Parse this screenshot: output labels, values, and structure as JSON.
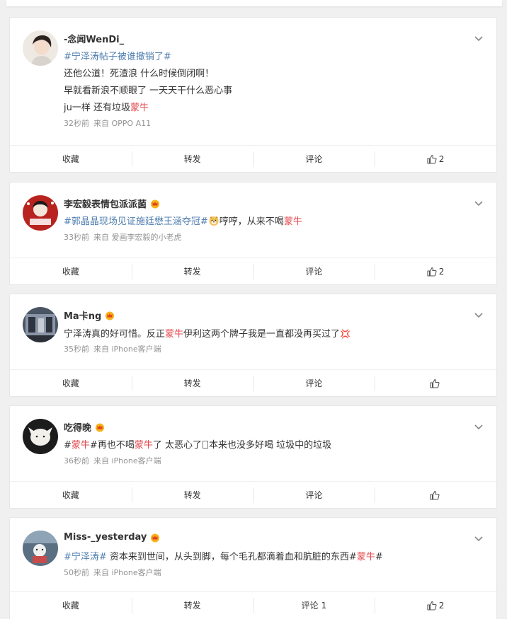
{
  "colors": {
    "topic": "#507daf",
    "highlight": "#e5484d",
    "meta": "#939393",
    "background": "#f0f0f0"
  },
  "action_labels": {
    "favorite": "收藏",
    "repost": "转发",
    "comment": "评论"
  },
  "posts": [
    {
      "username": "-念闻WenDi_",
      "has_crown": false,
      "lines": [
        [
          {
            "t": "#宁泽涛帖子被谁撤销了#",
            "s": "topic"
          }
        ],
        [
          {
            "t": "还他公道！死渣浪 什么时候倒闭啊！",
            "s": "plain"
          }
        ],
        [
          {
            "t": "早就看新浪不顺眼了 一天天干什么恶心事",
            "s": "plain"
          }
        ],
        [
          {
            "t": "ju一样 还有垃圾",
            "s": "plain"
          },
          {
            "t": "蒙牛",
            "s": "red"
          }
        ]
      ],
      "time": "32秒前",
      "source": "来自 OPPO A11",
      "comment_count": "",
      "like_count": "2"
    },
    {
      "username": "李宏毅表情包派派菌",
      "has_crown": true,
      "lines": [
        [
          {
            "t": "#郭晶晶现场见证施廷懋王涵夺冠#",
            "s": "topic"
          },
          {
            "t": "dog-emoji",
            "s": "emoji"
          },
          {
            "t": "哼哼，从来不喝",
            "s": "plain"
          },
          {
            "t": "蒙牛",
            "s": "red"
          }
        ]
      ],
      "time": "33秒前",
      "source": "来自 爱画李宏毅的小老虎",
      "comment_count": "",
      "like_count": "2"
    },
    {
      "username": "Ma卡ng",
      "has_crown": true,
      "lines": [
        [
          {
            "t": "宁泽涛真的好可惜。反正",
            "s": "plain"
          },
          {
            "t": "蒙牛",
            "s": "red"
          },
          {
            "t": "伊利这两个牌子我是一直都没再买过了",
            "s": "plain"
          },
          {
            "t": "💢",
            "s": "spark"
          }
        ]
      ],
      "time": "35秒前",
      "source": "来自 iPhone客户端",
      "comment_count": "",
      "like_count": ""
    },
    {
      "username": "吃得晚",
      "has_crown": true,
      "lines": [
        [
          {
            "t": "#",
            "s": "plain"
          },
          {
            "t": "蒙牛",
            "s": "red"
          },
          {
            "t": "#再也不喝",
            "s": "plain"
          },
          {
            "t": "蒙牛",
            "s": "red"
          },
          {
            "t": "了 太恶心了",
            "s": "plain"
          },
          {
            "t": "",
            "s": "box"
          },
          {
            "t": "本来也没多好喝 垃圾中的垃圾",
            "s": "plain"
          }
        ]
      ],
      "time": "36秒前",
      "source": "来自 iPhone客户端",
      "comment_count": "",
      "like_count": ""
    },
    {
      "username": "Miss-_yesterday",
      "has_crown": true,
      "lines": [
        [
          {
            "t": "#宁泽涛#",
            "s": "topic"
          },
          {
            "t": " 资本来到世间，从头到脚，每个毛孔都滴着血和肮脏的东西#",
            "s": "plain"
          },
          {
            "t": "蒙牛",
            "s": "red"
          },
          {
            "t": "#",
            "s": "plain"
          }
        ]
      ],
      "time": "50秒前",
      "source": "来自 iPhone客户端",
      "comment_count": "1",
      "like_count": "2"
    }
  ]
}
